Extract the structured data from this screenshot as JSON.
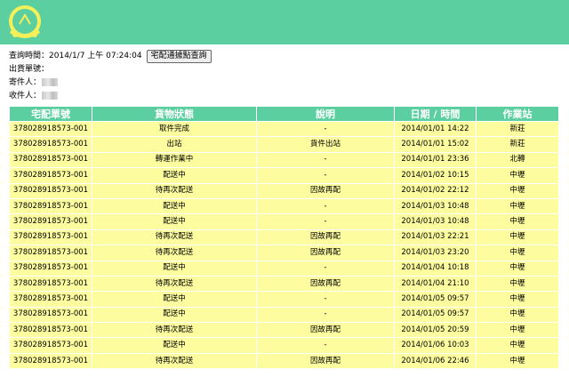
{
  "query": {
    "time_label": "查詢時間：",
    "time_value": "2014/1/7 上午 07:24:04",
    "button_label": "宅配通據點查詢"
  },
  "shipment": {
    "tracking_label": "出貨單號：",
    "sender_label": "寄件人：",
    "recipient_label": "收件人："
  },
  "table": {
    "headers": [
      "宅配單號",
      "貨物狀態",
      "說明",
      "日期 / 時間",
      "作業站"
    ],
    "rows": [
      [
        "378028918573-001",
        "取件完成",
        "-",
        "2014/01/01 14:22",
        "新莊"
      ],
      [
        "378028918573-001",
        "出站",
        "貨件出站",
        "2014/01/01 15:02",
        "新莊"
      ],
      [
        "378028918573-001",
        "轉運作業中",
        "-",
        "2014/01/01 23:36",
        "北轉"
      ],
      [
        "378028918573-001",
        "配送中",
        "-",
        "2014/01/02 10:15",
        "中壢"
      ],
      [
        "378028918573-001",
        "待再次配送",
        "因故再配",
        "2014/01/02 22:12",
        "中壢"
      ],
      [
        "378028918573-001",
        "配送中",
        "-",
        "2014/01/03 10:48",
        "中壢"
      ],
      [
        "378028918573-001",
        "配送中",
        "-",
        "2014/01/03 10:48",
        "中壢"
      ],
      [
        "378028918573-001",
        "待再次配送",
        "因故再配",
        "2014/01/03 22:21",
        "中壢"
      ],
      [
        "378028918573-001",
        "待再次配送",
        "因故再配",
        "2014/01/03 23:20",
        "中壢"
      ],
      [
        "378028918573-001",
        "配送中",
        "-",
        "2014/01/04 10:18",
        "中壢"
      ],
      [
        "378028918573-001",
        "待再次配送",
        "因故再配",
        "2014/01/04 21:10",
        "中壢"
      ],
      [
        "378028918573-001",
        "配送中",
        "-",
        "2014/01/05 09:57",
        "中壢"
      ],
      [
        "378028918573-001",
        "配送中",
        "-",
        "2014/01/05 09:57",
        "中壢"
      ],
      [
        "378028918573-001",
        "待再次配送",
        "因故再配",
        "2014/01/05 20:59",
        "中壢"
      ],
      [
        "378028918573-001",
        "配送中",
        "-",
        "2014/01/06 10:03",
        "中壢"
      ],
      [
        "378028918573-001",
        "待再次配送",
        "因故再配",
        "2014/01/06 22:46",
        "中壢"
      ]
    ]
  },
  "colors": {
    "brand_green": "#5ccfa0",
    "row_yellow": "#fdfd9f"
  },
  "icons": {
    "logo": "delivery-cart-logo-icon"
  }
}
